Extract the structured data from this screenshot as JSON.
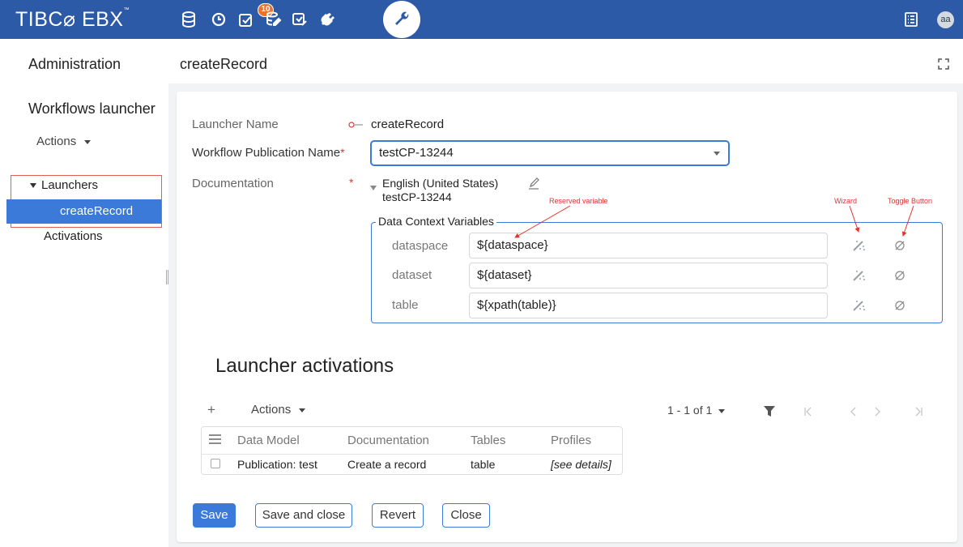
{
  "header": {
    "logo": "TIBC⌀ EBX",
    "logo_tm": "™",
    "notification_count": "10",
    "avatar_initials": "aa",
    "icons": [
      "database-icon",
      "history-icon",
      "tasks-icon",
      "dataspace-icon",
      "workflow-icon",
      "plug-icon",
      "wrench-icon",
      "menu-list-icon"
    ]
  },
  "left": {
    "title": "Administration",
    "subtitle": "Workflows launcher",
    "actions_label": "Actions",
    "tree": {
      "launchers_label": "Launchers",
      "selected_item": "createRecord",
      "activations_label": "Activations"
    }
  },
  "main": {
    "title": "createRecord",
    "form": {
      "launcher_name_label": "Launcher Name",
      "launcher_name_value": "createRecord",
      "publication_label": "Workflow Publication Name",
      "publication_value": "testCP-13244",
      "documentation_label": "Documentation",
      "doc_language": "English (United States)",
      "doc_value": "testCP-13244",
      "required_mark": "*"
    },
    "dcv": {
      "legend": "Data Context Variables",
      "rows": [
        {
          "name": "dataspace",
          "value": "${dataspace}"
        },
        {
          "name": "dataset",
          "value": "${dataset}"
        },
        {
          "name": "table",
          "value": "${xpath(table)}"
        }
      ]
    },
    "annotations": {
      "reserved": "Reserved variable",
      "wizard": "Wizard",
      "toggle": "Toggle Button"
    },
    "activations": {
      "title": "Launcher activations",
      "add_label": "+",
      "actions_label": "Actions",
      "pagination": "1 - 1 of 1",
      "columns": [
        "Data Model",
        "Documentation",
        "Tables",
        "Profiles"
      ],
      "rows": [
        {
          "data_model": "Publication: test",
          "documentation": "Create a record",
          "tables": "table",
          "profiles": "[see details]"
        }
      ]
    },
    "buttons": {
      "save": "Save",
      "save_close": "Save and close",
      "revert": "Revert",
      "close": "Close"
    }
  },
  "colors": {
    "header": "#2d5aa6",
    "accent": "#3c7ad9",
    "annotation": "#e1352b",
    "badge": "#e8742b"
  }
}
